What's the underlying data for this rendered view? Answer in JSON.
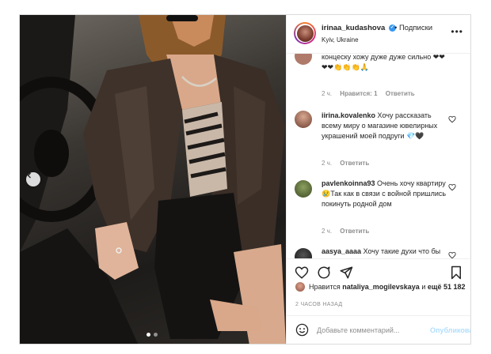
{
  "post": {
    "username": "irinaa_kudashova",
    "verified_mark": "✓",
    "separator": "•",
    "follow_label": "Подписки",
    "location": "Kyiv, Ukraine",
    "more_icon": "more-options-icon"
  },
  "comments": [
    {
      "username": "",
      "text": "концеску хожу дуже дуже сильно",
      "emoji": "❤❤❤❤👏👏👏🙏",
      "time": "2 ч.",
      "likes": "Нравится: 1",
      "reply": "Ответить",
      "avatar_color": "#b07a6a"
    },
    {
      "username": "iirina.kovalenko",
      "text": "Хочу рассказать всему миру о магазине ювелирных украшений моей подруги",
      "emoji": "💎🖤",
      "time": "2 ч.",
      "likes": "",
      "reply": "Ответить",
      "avatar_color": "#9a6b5a"
    },
    {
      "username": "pavlenkoinna93",
      "text": "Очень хочу квартиру😢Так как в связи с войной пришлись покинуть родной дом",
      "emoji": "",
      "time": "2 ч.",
      "likes": "",
      "reply": "Ответить",
      "avatar_color": "#5b6b3e"
    },
    {
      "username": "aasya_aaaa",
      "text": "Хочу такие духи что бы парни всем оборачивались",
      "emoji": "",
      "time": "",
      "likes": "",
      "reply": "",
      "avatar_color": "#2a2a2a"
    }
  ],
  "likes_line": {
    "prefix": "Нравится",
    "user": "nataliya_mogilevskaya",
    "suffix": "и",
    "more": "ещё 51 182"
  },
  "timestamp": "2 ЧАСОВ НАЗАД",
  "add_comment": {
    "placeholder": "Добавьте комментарий...",
    "publish_label": "Опубликовать"
  },
  "colors": {
    "accent": "#3897f0",
    "publish_disabled": "#b2dffc",
    "muted": "#8e8e8e",
    "border": "#dbdbdb"
  }
}
